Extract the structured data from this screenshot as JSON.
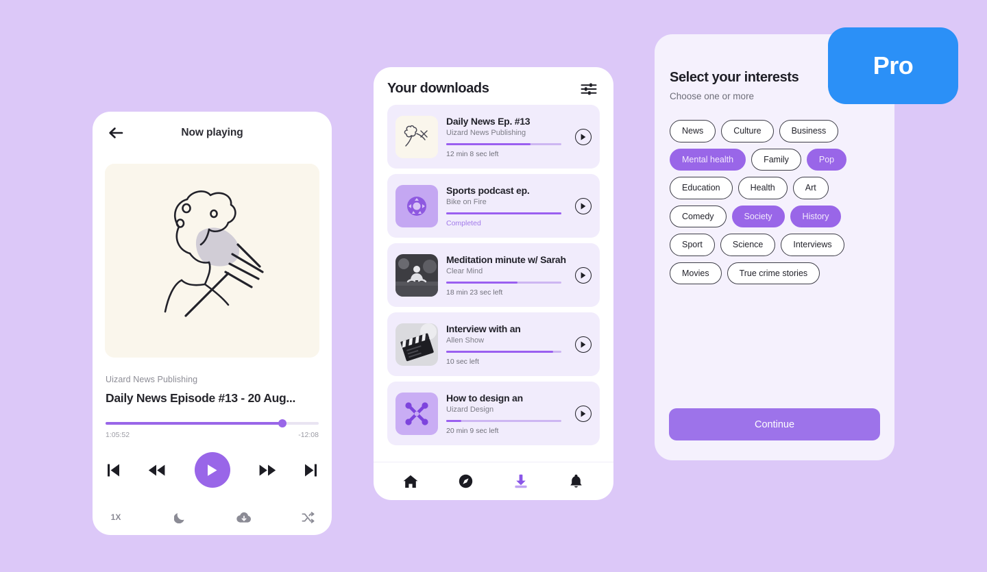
{
  "theme": {
    "page_background": "#DCC8F8",
    "accent_purple": "#9966E8",
    "pro_blue": "#2B90F7",
    "panel_white": "#FFFFFF",
    "interests_panel_bg": "#F5F1FD",
    "download_card_bg": "#F1ECFC",
    "album_art_bg": "#FAF6EC"
  },
  "player": {
    "back_icon": "arrow-left-icon",
    "header_title": "Now playing",
    "artwork_alt": "line-drawing-person-with-pencils",
    "publisher": "Uizard News Publishing",
    "title": "Daily News Episode #13 - 20 Aug...",
    "progress_percent": 83,
    "elapsed": "1:05:52",
    "remaining": "-12:08",
    "transport": [
      {
        "name": "skip-previous-button",
        "icon": "skip-back-icon"
      },
      {
        "name": "rewind-button",
        "icon": "rewind-icon"
      },
      {
        "name": "play-button",
        "icon": "play-icon"
      },
      {
        "name": "fast-forward-button",
        "icon": "fast-forward-icon"
      },
      {
        "name": "skip-next-button",
        "icon": "skip-forward-icon"
      }
    ],
    "extras": {
      "speed_label": "1X",
      "sleep_timer_icon": "moon-icon",
      "download_icon": "cloud-download-icon",
      "shuffle_icon": "shuffle-icon"
    }
  },
  "downloads": {
    "title": "Your downloads",
    "filter_icon": "sliders-icon",
    "items": [
      {
        "title": "Daily News Ep. #13",
        "author": "Uizard News Publishing",
        "progress_percent": 73,
        "status": "12 min 8 sec left",
        "completed": false,
        "thumb": "flower-sketch-thumb"
      },
      {
        "title": "Sports podcast ep.",
        "author": "Bike on Fire",
        "progress_percent": 100,
        "status": "Completed",
        "completed": true,
        "thumb": "ball-badge-thumb"
      },
      {
        "title": "Meditation minute w/ Sarah",
        "author": "Clear Mind",
        "progress_percent": 62,
        "status": "18 min 23 sec left",
        "completed": false,
        "thumb": "meditation-photo-thumb"
      },
      {
        "title": "Interview with an",
        "author": "Allen Show",
        "progress_percent": 93,
        "status": "10 sec left",
        "completed": false,
        "thumb": "clapperboard-photo-thumb"
      },
      {
        "title": "How to design an",
        "author": "Uizard Design",
        "progress_percent": 13,
        "status": "20 min 9 sec left",
        "completed": false,
        "thumb": "crossed-tools-thumb"
      }
    ],
    "nav": [
      {
        "name": "nav-home",
        "icon": "home-icon",
        "active": false
      },
      {
        "name": "nav-discover",
        "icon": "compass-icon",
        "active": false
      },
      {
        "name": "nav-downloads",
        "icon": "download-icon",
        "active": true
      },
      {
        "name": "nav-notifications",
        "icon": "bell-icon",
        "active": false
      }
    ]
  },
  "interests": {
    "title": "Select your interests",
    "subtitle": "Choose one or more",
    "chips": [
      {
        "label": "News",
        "selected": false
      },
      {
        "label": "Culture",
        "selected": false
      },
      {
        "label": "Business",
        "selected": false
      },
      {
        "label": "Mental health",
        "selected": true
      },
      {
        "label": "Family",
        "selected": false
      },
      {
        "label": "Pop",
        "selected": true
      },
      {
        "label": "Education",
        "selected": false
      },
      {
        "label": "Health",
        "selected": false
      },
      {
        "label": "Art",
        "selected": false
      },
      {
        "label": "Comedy",
        "selected": false
      },
      {
        "label": "Society",
        "selected": true
      },
      {
        "label": "History",
        "selected": true
      },
      {
        "label": "Sport",
        "selected": false
      },
      {
        "label": "Science",
        "selected": false
      },
      {
        "label": "Interviews",
        "selected": false
      },
      {
        "label": "Movies",
        "selected": false
      },
      {
        "label": "True crime stories",
        "selected": false
      }
    ],
    "continue_label": "Continue"
  },
  "pro_badge": {
    "label": "Pro"
  }
}
